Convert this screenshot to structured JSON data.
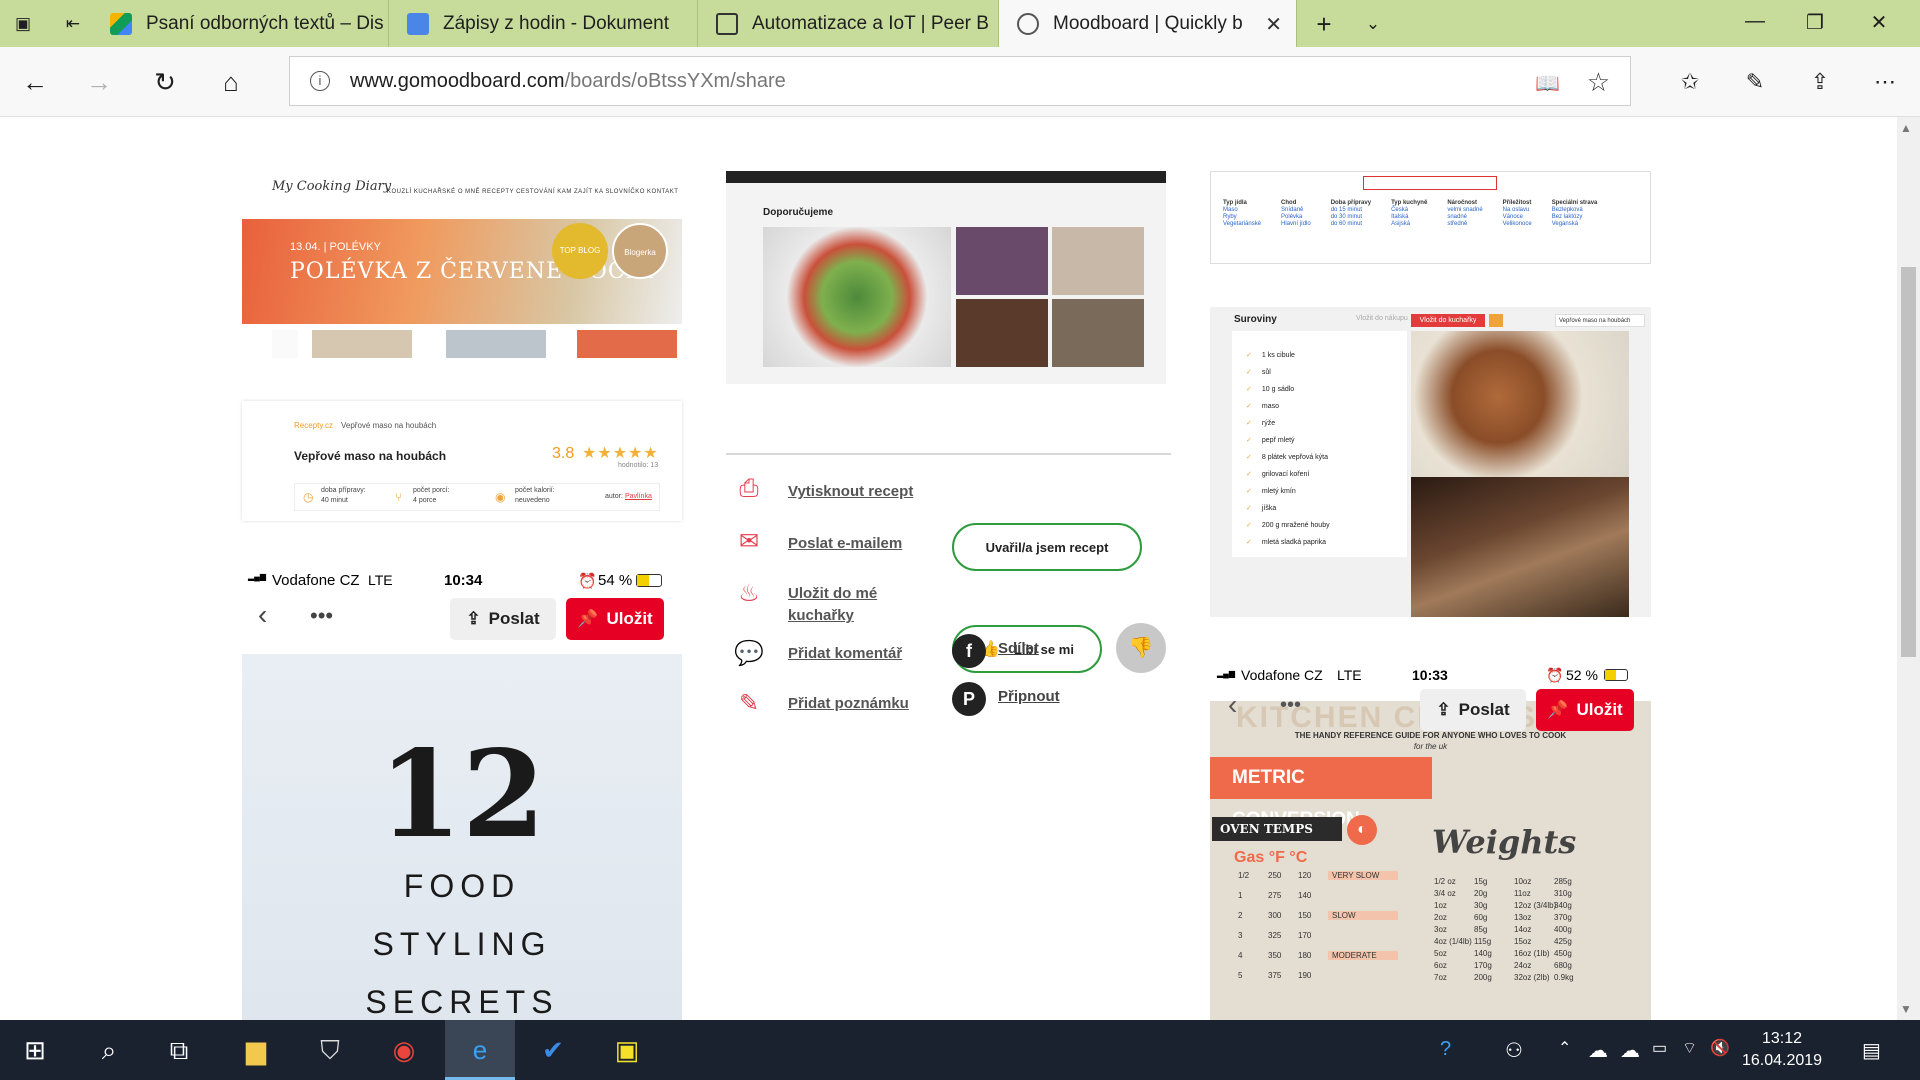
{
  "browser": {
    "tabs": [
      {
        "title": "Psaní odborných textů – Dis",
        "icon": "drive-icon"
      },
      {
        "title": "Zápisy z hodin - Dokument",
        "icon": "docs-icon"
      },
      {
        "title": "Automatizace a IoT | Peer B",
        "icon": "page-icon"
      },
      {
        "title": "Moodboard | Quickly b",
        "icon": "moodboard-icon",
        "active": true
      }
    ],
    "url_host": "www.gomoodboard.com",
    "url_path": "/boards/oBtssYXm/share"
  },
  "card_diary": {
    "logo": "My Cooking Diary",
    "menu": "KOUZLÍ KUCHAŘSKÉ   O MNĚ   RECEPTY   CESTOVÁNÍ   KAM ZAJÍT   KA SLOVNÍČKO   KONTAKT",
    "date": "13.04. | POLÉVKY",
    "hero_title": "POLÉVKA Z ČERVENÉ ČOČKY",
    "badge1": "TOP BLOG",
    "badge2": "Blogerka"
  },
  "card_recipe": {
    "breadcrumb_home": "Recepty.cz",
    "breadcrumb_current": "Vepřové maso na houbách",
    "title": "Vepřové maso na houbách",
    "rating": "3.8",
    "stars": "★★★★★",
    "votes": "hodnotilo: 13",
    "prep_label": "doba přípravy:",
    "prep_value": "40 minut",
    "portions_label": "počet porcí:",
    "portions_value": "4 porce",
    "kcal_label": "počet kalorií:",
    "kcal_value": "neuvedeno",
    "author_label": "autor:",
    "author_value": "Pavlínka"
  },
  "phone_left": {
    "carrier": "Vodafone CZ",
    "network": "LTE",
    "time": "10:34",
    "battery": "54 %",
    "send_label": "Poslat",
    "save_label": "Uložit"
  },
  "card_styling": {
    "number": "12",
    "line1": "FOOD",
    "line2": "STYLING",
    "line3": "SECRETS"
  },
  "card_recommend": {
    "heading": "Doporučujeme"
  },
  "actions": {
    "print": "Vytisknout recept",
    "email": "Poslat e-mailem",
    "save_cookbook": "Uložit do mé kuchařky",
    "comment": "Přidat komentář",
    "note": "Přidat poznámku",
    "cooked": "Uvařil/a jsem recept",
    "like": "Líbí se mi",
    "share": "Sdílet",
    "pin": "Připnout"
  },
  "card_filter": {
    "headers": [
      "Typ jídla",
      "Chod",
      "Doba přípravy",
      "Typ kuchyně",
      "Náročnost",
      "Příležitost",
      "Speciální strava"
    ],
    "rows": [
      [
        "Maso",
        "Snídaně",
        "do 15 minut",
        "Česká",
        "velmi snadné",
        "Na oslavu",
        "Bezlepková"
      ],
      [
        "Ryby",
        "Polévka",
        "do 30 minut",
        "Italská",
        "snadné",
        "Vánoce",
        "Bez laktózy"
      ],
      [
        "Vegetariánské",
        "Hlavní jídlo",
        "do 60 minut",
        "Asijská",
        "středně",
        "Velikonoce",
        "Veganská"
      ]
    ]
  },
  "card_ingredients": {
    "heading": "Suroviny",
    "add_cart": "Vložit do nákupu",
    "add_cookbook": "Vložit do kuchařky",
    "select": "Vepřové maso na houbách",
    "items": [
      "1 ks cibule",
      "sůl",
      "10 g sádlo",
      "maso",
      "rýže",
      "pepř mletý",
      "8 plátek vepřová kýta",
      "grilovací koření",
      "mletý kmín",
      "jíška",
      "200 g mražené houby",
      "mletá sladká paprika"
    ]
  },
  "phone_right": {
    "carrier": "Vodafone CZ",
    "network": "LTE",
    "time": "10:33",
    "battery": "52 %",
    "send_label": "Poslat",
    "save_label": "Uložit"
  },
  "card_kitchen": {
    "title": "KITCHEN CHEAT SHEET",
    "subtitle": "THE HANDY REFERENCE GUIDE FOR ANYONE WHO LOVES TO COOK",
    "subtitle2": "for the uk",
    "banner": "METRIC CONVERSION",
    "oven": "OVEN TEMPS",
    "gas_header": "Gas °F °C",
    "oven_rows": [
      [
        "1/2",
        "250",
        "120",
        "VERY SLOW"
      ],
      [
        "1",
        "275",
        "140",
        ""
      ],
      [
        "2",
        "300",
        "150",
        "SLOW"
      ],
      [
        "3",
        "325",
        "170",
        ""
      ],
      [
        "4",
        "350",
        "180",
        "MODERATE"
      ],
      [
        "5",
        "375",
        "190",
        ""
      ]
    ],
    "weights": "Weights",
    "weight_rows": [
      [
        "1/2 oz",
        "15g",
        "10oz",
        "285g"
      ],
      [
        "3/4 oz",
        "20g",
        "11oz",
        "310g"
      ],
      [
        "1oz",
        "30g",
        "12oz (3/4lb)",
        "340g"
      ],
      [
        "2oz",
        "60g",
        "13oz",
        "370g"
      ],
      [
        "3oz",
        "85g",
        "14oz",
        "400g"
      ],
      [
        "4oz (1/4lb)",
        "115g",
        "15oz",
        "425g"
      ],
      [
        "5oz",
        "140g",
        "16oz (1lb)",
        "450g"
      ],
      [
        "6oz",
        "170g",
        "24oz",
        "680g"
      ],
      [
        "7oz",
        "200g",
        "32oz (2lb)",
        "0.9kg"
      ]
    ]
  },
  "taskbar": {
    "time": "13:12",
    "date": "16.04.2019"
  }
}
